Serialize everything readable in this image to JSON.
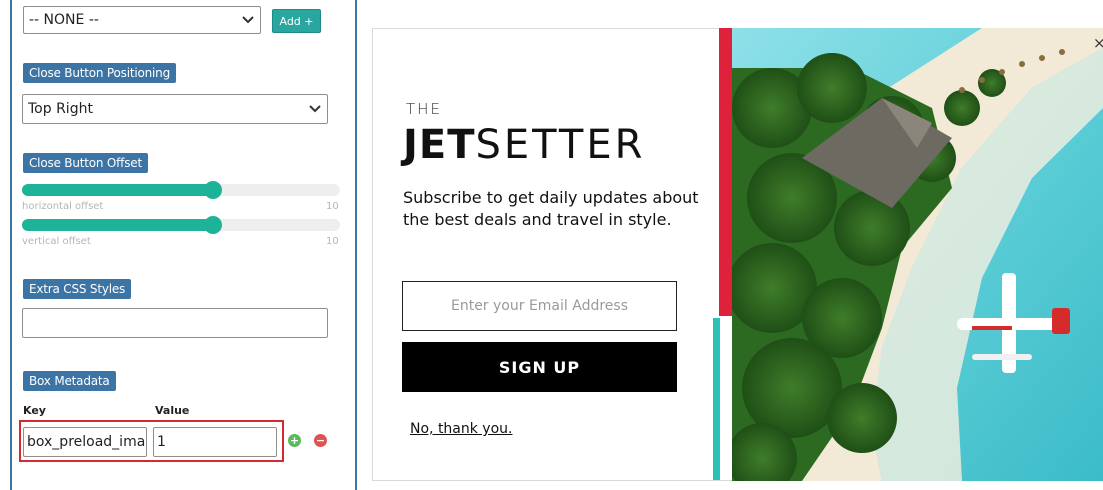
{
  "settings": {
    "box_select": {
      "value": "-- NONE --"
    },
    "add_button": {
      "label": "Add +"
    },
    "close_position": {
      "label": "Close Button Positioning",
      "value": "Top Right"
    },
    "close_offset": {
      "label": "Close Button Offset",
      "horizontal": {
        "label": "horizontal offset",
        "value": 6,
        "max": 10,
        "max_label": "10"
      },
      "vertical": {
        "label": "vertical offset",
        "value": 6,
        "max": 10,
        "max_label": "10"
      }
    },
    "extra_css": {
      "label": "Extra CSS Styles",
      "value": ""
    },
    "metadata": {
      "label": "Box Metadata",
      "key_header": "Key",
      "value_header": "Value",
      "row": {
        "key": "box_preload_image",
        "value": "1"
      },
      "add_icon": "plus-circle-icon",
      "remove_icon": "minus-circle-icon"
    }
  },
  "popup": {
    "brand_the": "THE",
    "brand_jet": "JET",
    "brand_setter": "SETTER",
    "subtitle": "Subscribe to get daily updates about the best deals and travel in style.",
    "email_placeholder": "Enter your Email Address",
    "signup_label": "SIGN UP",
    "decline_label": "No, thank you.",
    "close_label": "×"
  },
  "colors": {
    "panel_accent": "#3c74a5",
    "slider": "#1db399",
    "add_button": "#2aa6a0",
    "highlight": "#d62b2b",
    "popup_red": "#e0213c",
    "popup_teal": "#28c2b7",
    "plus_icon": "#5cb85c",
    "minus_icon": "#e05252"
  }
}
